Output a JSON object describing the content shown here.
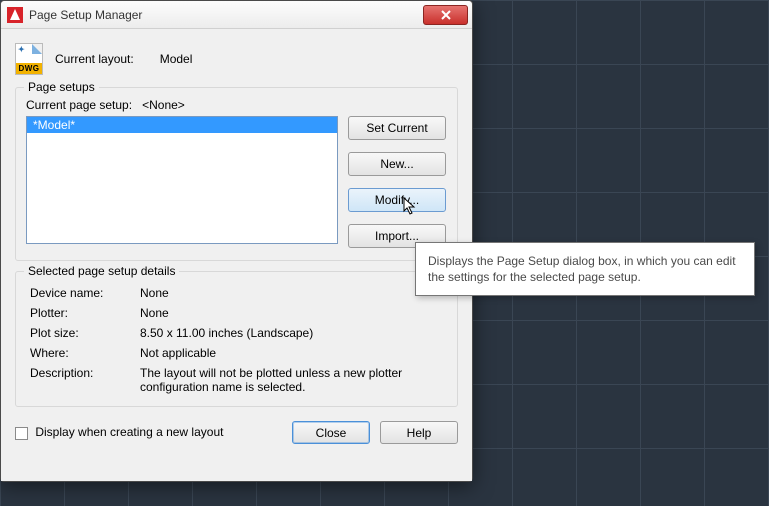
{
  "window": {
    "title": "Page Setup Manager",
    "close_glyph": "✕"
  },
  "header": {
    "dwg_band": "DWG",
    "layout_label": "Current layout:",
    "layout_value": "Model"
  },
  "page_setups": {
    "legend": "Page setups",
    "cps_label": "Current page setup:",
    "cps_value": "<None>",
    "list": {
      "items": [
        "*Model*"
      ]
    },
    "buttons": {
      "set_current": "Set Current",
      "new": "New...",
      "modify": "Modify...",
      "import": "Import..."
    }
  },
  "details": {
    "legend": "Selected page setup details",
    "rows": {
      "device_label": "Device name:",
      "device_value": "None",
      "plotter_label": "Plotter:",
      "plotter_value": "None",
      "plotsize_label": "Plot size:",
      "plotsize_value": "8.50 x 11.00 inches (Landscape)",
      "where_label": "Where:",
      "where_value": "Not applicable",
      "desc_label": "Description:",
      "desc_value": "The layout will not be plotted unless a new plotter configuration name is selected."
    }
  },
  "footer": {
    "checkbox_label": "Display when creating a new layout",
    "close": "Close",
    "help": "Help"
  },
  "tooltip": {
    "text": "Displays the Page Setup dialog box, in which you can edit the settings for the selected page setup."
  }
}
